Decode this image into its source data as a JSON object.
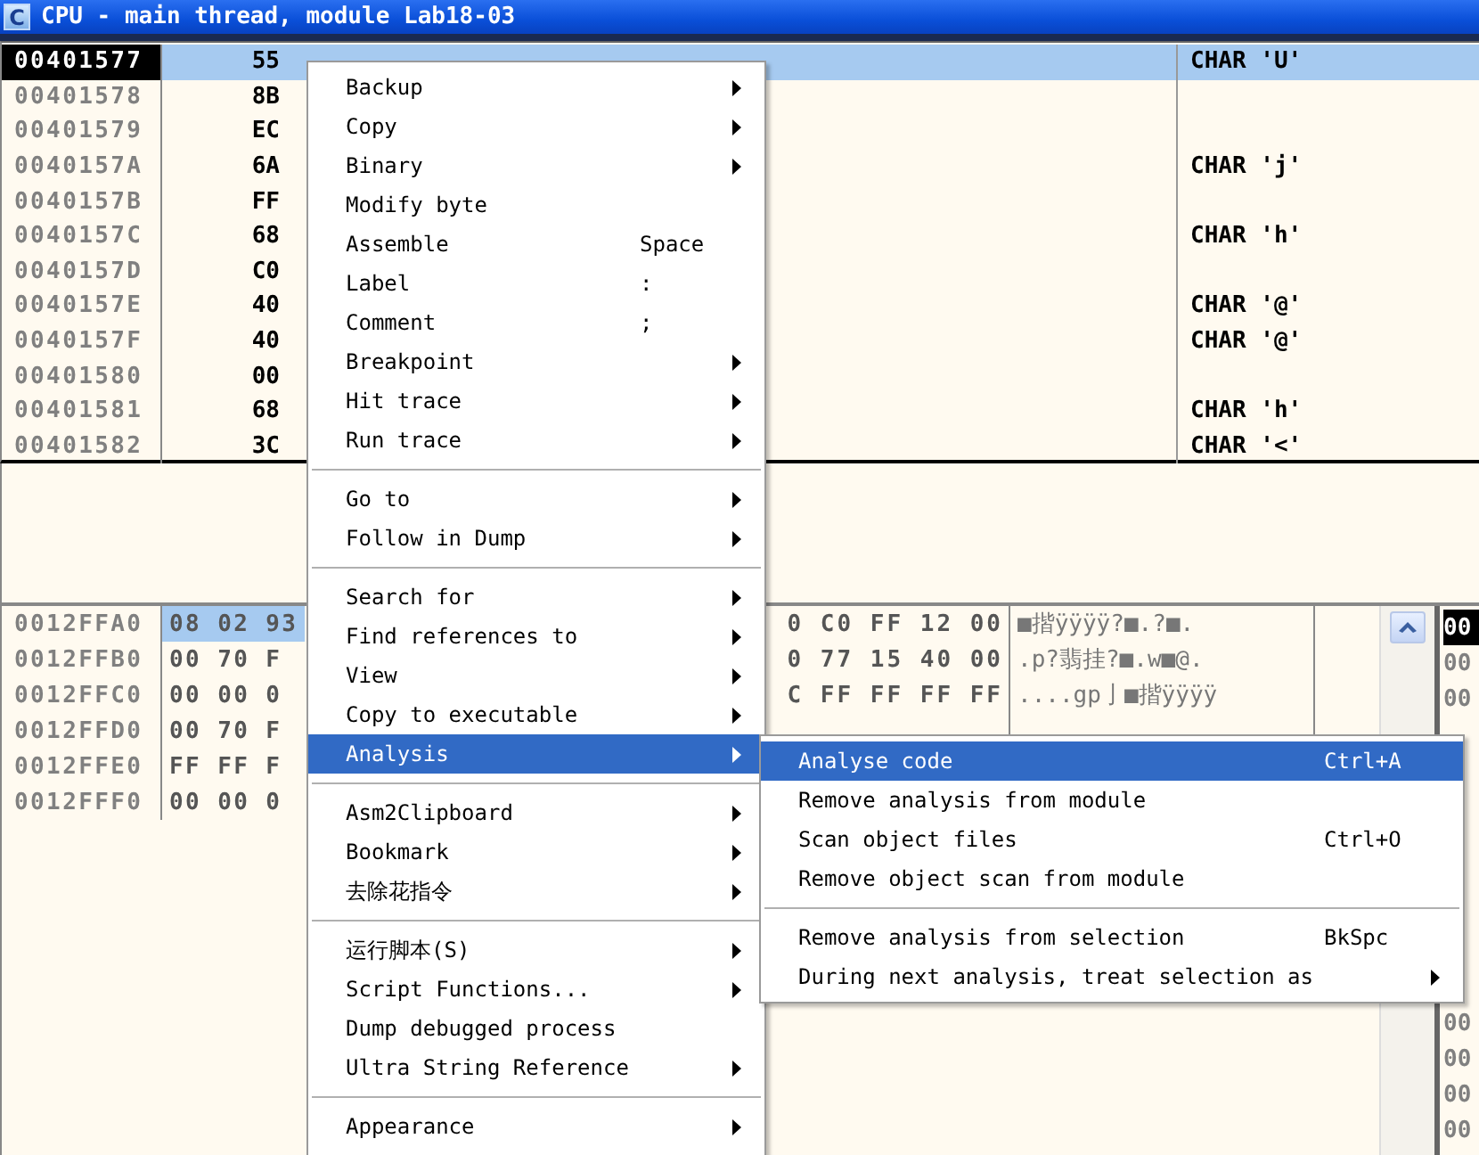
{
  "window": {
    "icon_letter": "C",
    "title": "CPU - main thread, module Lab18-03"
  },
  "disassembly": {
    "rows": [
      {
        "address": "00401577",
        "hex": "55",
        "comment": "CHAR 'U'",
        "selected": true
      },
      {
        "address": "00401578",
        "hex": "8B",
        "selected": false
      },
      {
        "address": "00401579",
        "hex": "EC",
        "selected": false
      },
      {
        "address": "0040157A",
        "hex": "6A",
        "comment": "CHAR 'j'",
        "selected": false
      },
      {
        "address": "0040157B",
        "hex": "FF",
        "selected": false
      },
      {
        "address": "0040157C",
        "hex": "68",
        "comment": "CHAR 'h'",
        "selected": false
      },
      {
        "address": "0040157D",
        "hex": "C0",
        "selected": false
      },
      {
        "address": "0040157E",
        "hex": "40",
        "comment": "CHAR '@'",
        "selected": false
      },
      {
        "address": "0040157F",
        "hex": "40",
        "comment": "CHAR '@'",
        "selected": false
      },
      {
        "address": "00401580",
        "hex": "00",
        "selected": false
      },
      {
        "address": "00401581",
        "hex": "68",
        "comment": "CHAR 'h'",
        "selected": false
      },
      {
        "address": "00401582",
        "hex": "3C",
        "comment": "CHAR '<'",
        "selected": false
      }
    ]
  },
  "dump": {
    "rows": [
      {
        "address": "0012FFA0",
        "hex_left": "08 02 93",
        "hex_right": "0 C0 FF 12 00",
        "ascii": "■揩ÿÿÿÿ?■.?■.",
        "selected": true
      },
      {
        "address": "0012FFB0",
        "hex_left": "00 70 F",
        "hex_right": "0 77 15 40 00",
        "ascii": ".p?翡挂?■.w■@.",
        "selected": false
      },
      {
        "address": "0012FFC0",
        "hex_left": "00 00 0",
        "hex_right": "C FF FF FF FF",
        "ascii": "....gp亅■揩ÿÿÿÿ",
        "selected": false
      },
      {
        "address": "0012FFD0",
        "hex_left": "00 70 F",
        "selected": false
      },
      {
        "address": "0012FFE0",
        "hex_left": "FF FF F",
        "selected": false
      },
      {
        "address": "0012FFF0",
        "hex_left": "00 00 0",
        "selected": false
      }
    ]
  },
  "stack": {
    "rows_top": [
      {
        "text": "00",
        "selected": true
      },
      {
        "text": "00",
        "selected": false
      },
      {
        "text": "00",
        "selected": false
      }
    ],
    "rows_bottom": [
      {
        "text": "00",
        "selected": false
      },
      {
        "text": "00",
        "selected": false
      },
      {
        "text": "00",
        "selected": false
      },
      {
        "text": "00",
        "selected": false
      }
    ]
  },
  "context_menu": {
    "groups": [
      [
        {
          "label": "Backup",
          "submenu": true,
          "selected": false
        },
        {
          "label": "Copy",
          "submenu": true,
          "selected": false
        },
        {
          "label": "Binary",
          "submenu": true,
          "selected": false
        },
        {
          "label": "Modify byte",
          "submenu": false,
          "selected": false
        },
        {
          "label": "Assemble",
          "shortcut": "Space",
          "submenu": false,
          "selected": false
        },
        {
          "label": "Label",
          "shortcut": ":",
          "submenu": false,
          "selected": false
        },
        {
          "label": "Comment",
          "shortcut": ";",
          "submenu": false,
          "selected": false
        },
        {
          "label": "Breakpoint",
          "submenu": true,
          "selected": false
        },
        {
          "label": "Hit trace",
          "submenu": true,
          "selected": false
        },
        {
          "label": "Run trace",
          "submenu": true,
          "selected": false
        }
      ],
      [
        {
          "label": "Go to",
          "submenu": true,
          "selected": false
        },
        {
          "label": "Follow in Dump",
          "submenu": true,
          "selected": false
        }
      ],
      [
        {
          "label": "Search for",
          "submenu": true,
          "selected": false
        },
        {
          "label": "Find references to",
          "submenu": true,
          "selected": false
        },
        {
          "label": "View",
          "submenu": true,
          "selected": false
        },
        {
          "label": "Copy to executable",
          "submenu": true,
          "selected": false
        },
        {
          "label": "Analysis",
          "submenu": true,
          "selected": true
        }
      ],
      [
        {
          "label": "Asm2Clipboard",
          "submenu": true,
          "selected": false
        },
        {
          "label": "Bookmark",
          "submenu": true,
          "selected": false
        },
        {
          "label": "去除花指令",
          "submenu": true,
          "selected": false
        }
      ],
      [
        {
          "label": "运行脚本(S)",
          "submenu": true,
          "selected": false
        },
        {
          "label": "Script Functions...",
          "submenu": true,
          "selected": false
        },
        {
          "label": "Dump debugged process",
          "submenu": false,
          "selected": false
        },
        {
          "label": "Ultra String Reference",
          "submenu": true,
          "selected": false
        }
      ],
      [
        {
          "label": "Appearance",
          "submenu": true,
          "selected": false
        }
      ]
    ]
  },
  "analysis_submenu": {
    "groups": [
      [
        {
          "label": "Analyse code",
          "shortcut": "Ctrl+A",
          "submenu": false,
          "selected": true
        },
        {
          "label": "Remove analysis from module",
          "submenu": false,
          "selected": false
        },
        {
          "label": "Scan object files",
          "shortcut": "Ctrl+O",
          "submenu": false,
          "selected": false
        },
        {
          "label": "Remove object scan from module",
          "submenu": false,
          "selected": false
        }
      ],
      [
        {
          "label": "Remove analysis from selection",
          "shortcut": "BkSpc",
          "submenu": false,
          "selected": false
        },
        {
          "label": "During next analysis, treat selection as",
          "submenu": true,
          "selected": false
        }
      ]
    ]
  }
}
